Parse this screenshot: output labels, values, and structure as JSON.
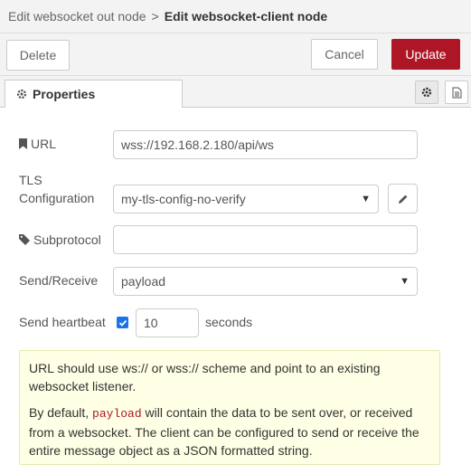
{
  "breadcrumb": {
    "parent": "Edit websocket out node",
    "separator": ">",
    "current": "Edit websocket-client node"
  },
  "toolbar": {
    "delete_label": "Delete",
    "cancel_label": "Cancel",
    "update_label": "Update"
  },
  "tabs": {
    "properties_label": "Properties"
  },
  "form": {
    "url_label": "URL",
    "url_value": "wss://192.168.2.180/api/ws",
    "tls_label_line1": "TLS",
    "tls_label_line2": "Configuration",
    "tls_value": "my-tls-config-no-verify",
    "subprotocol_label": "Subprotocol",
    "subprotocol_value": "",
    "send_receive_label": "Send/Receive",
    "send_receive_value": "payload",
    "heartbeat_label": "Send heartbeat",
    "heartbeat_checked": true,
    "heartbeat_value": "10",
    "heartbeat_unit": "seconds"
  },
  "tip": {
    "p1": "URL should use ws:// or wss:// scheme and point to an existing websocket listener.",
    "p2_before": "By default, ",
    "p2_code": "payload",
    "p2_after": " will contain the data to be sent over, or received from a websocket. The client can be configured to send or receive the entire message object as a JSON formatted string."
  },
  "colors": {
    "accent": "#AD1625",
    "checkbox": "#1a73e8",
    "tip_bg": "#ffffe6"
  }
}
